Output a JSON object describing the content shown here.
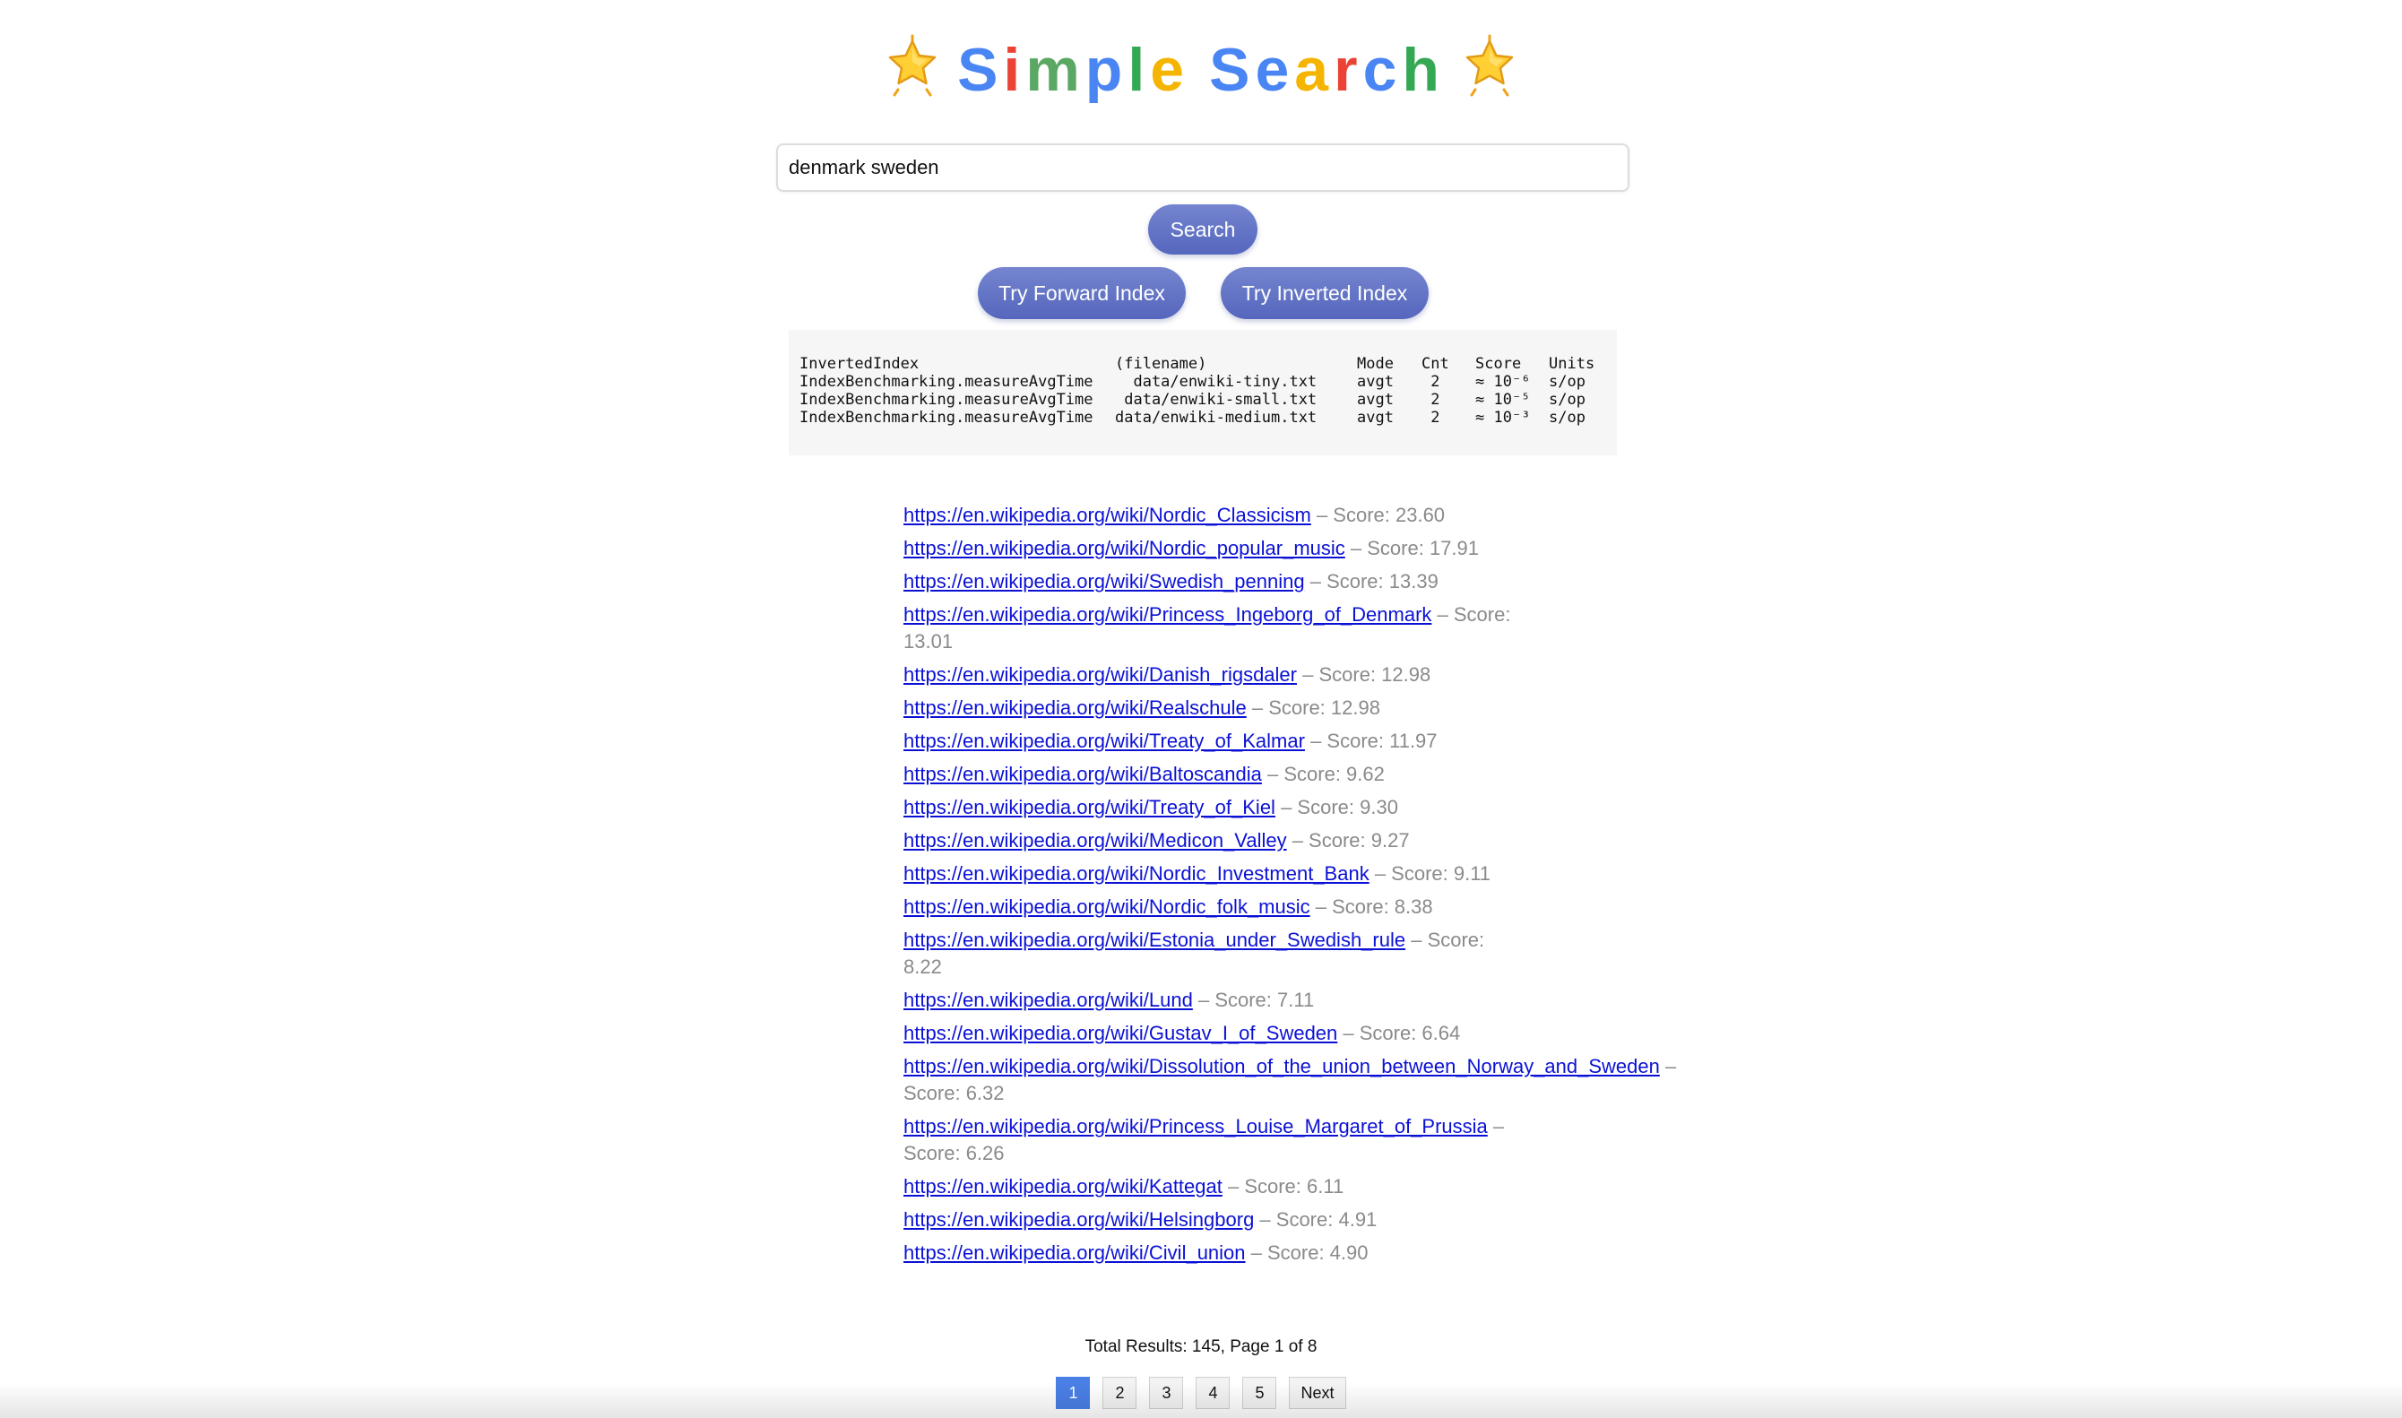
{
  "header": {
    "title_letters": [
      {
        "ch": "S",
        "color": "#4a85f4"
      },
      {
        "ch": "i",
        "color": "#ea4335"
      },
      {
        "ch": "m",
        "color": "#5aa864"
      },
      {
        "ch": "p",
        "color": "#4a85f4"
      },
      {
        "ch": "l",
        "color": "#34a853"
      },
      {
        "ch": "e",
        "color": "#f4b400"
      },
      {
        "ch": " ",
        "color": "#000000"
      },
      {
        "ch": "S",
        "color": "#4a85f4"
      },
      {
        "ch": "e",
        "color": "#4a85f4"
      },
      {
        "ch": "a",
        "color": "#f4b400"
      },
      {
        "ch": "r",
        "color": "#ea4335"
      },
      {
        "ch": "c",
        "color": "#4a85f4"
      },
      {
        "ch": "h",
        "color": "#34a853"
      }
    ],
    "star_icon": "star-icon"
  },
  "search": {
    "value": "denmark sweden",
    "button_label": "Search"
  },
  "actions": {
    "forward_label": "Try Forward Index",
    "inverted_label": "Try Inverted Index"
  },
  "benchmark": {
    "header": [
      "InvertedIndex",
      "(filename)",
      "Mode",
      "Cnt",
      "Score",
      "Units"
    ],
    "rows": [
      [
        "IndexBenchmarking.measureAvgTime",
        "  data/enwiki-tiny.txt",
        "avgt",
        " 2",
        "≈ 10⁻⁶",
        "s/op"
      ],
      [
        "IndexBenchmarking.measureAvgTime",
        " data/enwiki-small.txt",
        "avgt",
        " 2",
        "≈ 10⁻⁵",
        "s/op"
      ],
      [
        "IndexBenchmarking.measureAvgTime",
        "data/enwiki-medium.txt",
        "avgt",
        " 2",
        "≈ 10⁻³",
        "s/op"
      ]
    ]
  },
  "results": [
    {
      "url": "https://en.wikipedia.org/wiki/Nordic_Classicism",
      "score": "– Score: 23.60",
      "wrap": "wrap-wide"
    },
    {
      "url": "https://en.wikipedia.org/wiki/Nordic_popular_music",
      "score": "– Score: 17.91",
      "wrap": "wrap-wide"
    },
    {
      "url": "https://en.wikipedia.org/wiki/Swedish_penning",
      "score": "– Score: 13.39",
      "wrap": "wrap-wide"
    },
    {
      "url": "https://en.wikipedia.org/wiki/Princess_Ingeborg_of_Denmark",
      "score": "– Score: 13.01",
      "wrap": "wrap-mid"
    },
    {
      "url": "https://en.wikipedia.org/wiki/Danish_rigsdaler",
      "score": "– Score: 12.98",
      "wrap": "wrap-wide"
    },
    {
      "url": "https://en.wikipedia.org/wiki/Realschule",
      "score": "– Score: 12.98",
      "wrap": "wrap-wide"
    },
    {
      "url": "https://en.wikipedia.org/wiki/Treaty_of_Kalmar",
      "score": "– Score: 11.97",
      "wrap": "wrap-wide"
    },
    {
      "url": "https://en.wikipedia.org/wiki/Baltoscandia",
      "score": "– Score: 9.62",
      "wrap": "wrap-wide"
    },
    {
      "url": "https://en.wikipedia.org/wiki/Treaty_of_Kiel",
      "score": "– Score: 9.30",
      "wrap": "wrap-wide"
    },
    {
      "url": "https://en.wikipedia.org/wiki/Medicon_Valley",
      "score": "– Score: 9.27",
      "wrap": "wrap-wide"
    },
    {
      "url": "https://en.wikipedia.org/wiki/Nordic_Investment_Bank",
      "score": "– Score: 9.11",
      "wrap": "wrap-narrow"
    },
    {
      "url": "https://en.wikipedia.org/wiki/Nordic_folk_music",
      "score": "– Score: 8.38",
      "wrap": "wrap-wide"
    },
    {
      "url": "https://en.wikipedia.org/wiki/Estonia_under_Swedish_rule",
      "score": "– Score: 8.22",
      "wrap": "wrap-narrow"
    },
    {
      "url": "https://en.wikipedia.org/wiki/Lund",
      "score": "– Score: 7.11",
      "wrap": "wrap-wide"
    },
    {
      "url": "https://en.wikipedia.org/wiki/Gustav_I_of_Sweden",
      "score": "– Score: 6.64",
      "wrap": "wrap-wide"
    },
    {
      "url": "https://en.wikipedia.org/wiki/Dissolution_of_the_union_between_Norway_and_Sweden",
      "score": "– Score: 6.32",
      "wrap": "wrap-wide"
    },
    {
      "url": "https://en.wikipedia.org/wiki/Princess_Louise_Margaret_of_Prussia",
      "score": "– Score: 6.26",
      "wrap": "wrap-mid"
    },
    {
      "url": "https://en.wikipedia.org/wiki/Kattegat",
      "score": "– Score: 6.11",
      "wrap": "wrap-wide"
    },
    {
      "url": "https://en.wikipedia.org/wiki/Helsingborg",
      "score": "– Score: 4.91",
      "wrap": "wrap-wide"
    },
    {
      "url": "https://en.wikipedia.org/wiki/Civil_union",
      "score": "– Score: 4.90",
      "wrap": "wrap-wide"
    }
  ],
  "summary": {
    "total_text": "Total Results: 145, Page 1 of 8"
  },
  "pagination": {
    "pages": [
      "1",
      "2",
      "3",
      "4",
      "5"
    ],
    "active": "1",
    "next_label": "Next"
  }
}
